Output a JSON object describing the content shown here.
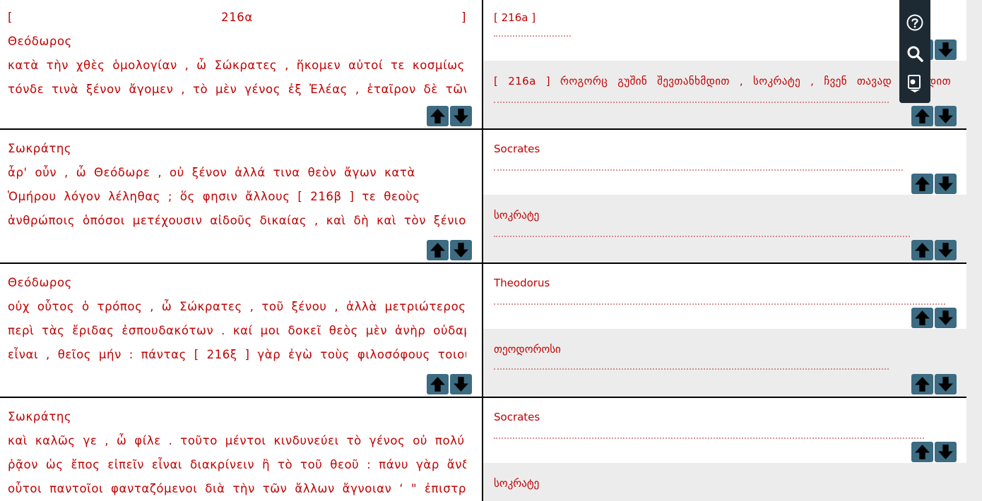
{
  "left": {
    "rows": [
      {
        "speaker": "Θεόδωρος",
        "lines": [
          "[ 216α ]",
          "κατὰ τὴν χθὲς ὁμολογίαν , ὦ Σώκρατες , ἥκομεν αὐτοί τε κοσμίως καὶ",
          "τόνδε τινὰ ξένον ἄγομεν , τὸ μὲν γένος ἐξ Ἐλέας , ἑταῖρον δὲ τῶν"
        ]
      },
      {
        "speaker": "Σωκράτης",
        "lines": [
          "ἆρ' οὖν , ὦ Θεόδωρε , οὐ ξένον ἀλλά τινα θεὸν ἄγων κατὰ τὸν",
          "Ὁμήρου λόγον λέληθας ; ὅς φησιν ἄλλους [ 216β ] τε θεοὺς τοῖς",
          "ἀνθρώποις ὁπόσοι μετέχουσιν αἰδοῦς δικαίας , καὶ δὴ καὶ τὸν ξένιον οὐχ"
        ]
      },
      {
        "speaker": "Θεόδωρος",
        "lines": [
          "οὐχ οὗτος ὁ τρόπος , ὦ Σώκρατες , τοῦ ξένου , ἀλλὰ μετριώτερος τῶν",
          "περὶ τὰς ἔριδας ἐσπουδακότων . καί μοι δοκεῖ θεὸς μὲν ἀνὴρ οὐδαμῶς",
          "εἶναι , θεῖος μήν : πάντας [ 216ξ ] γὰρ ἐγὼ τοὺς φιλοσόφους τοιούτους"
        ]
      },
      {
        "speaker": "Σωκράτης",
        "lines": [
          "καὶ καλῶς γε , ὦ φίλε . τοῦτο μέντοι κινδυνεύει τὸ γένος οὐ πολύ τι",
          "ῥᾷον ὡς ἔπος εἰπεῖν εἶναι διακρίνειν ἢ τὸ τοῦ θεοῦ : πάνυ γὰρ ἄνδρες",
          "οὗτοι παντοῖοι φανταζόμενοι διὰ τὴν τῶν ἄλλων ἄγνοιαν ‘ \" ἐπιστρωφῶσι"
        ]
      }
    ]
  },
  "right": {
    "rows": [
      {
        "label": "[ 216a ]",
        "lines": []
      },
      {
        "label": "",
        "lines": [
          "[ 216a ] როგორც გუშინ შევთანხმდით , სოკრატე , ჩვენ თავად მოვედით"
        ]
      },
      {
        "label": "Socrates",
        "lines": []
      },
      {
        "label": "სოკრატე",
        "lines": []
      },
      {
        "label": "Theodorus",
        "lines": []
      },
      {
        "label": "თეოდოროსი",
        "lines": []
      },
      {
        "label": "Socrates",
        "lines": []
      },
      {
        "label": "სოკრატე",
        "lines": []
      }
    ]
  },
  "toolbar": {
    "help_icon": "help-icon",
    "search_icon": "search-icon",
    "book_icon": "book-icon"
  },
  "colors": {
    "text": "#c00000",
    "arrow_button": "#3d6b82",
    "toolbar": "#1e2a33",
    "grey_row": "#ececec"
  }
}
